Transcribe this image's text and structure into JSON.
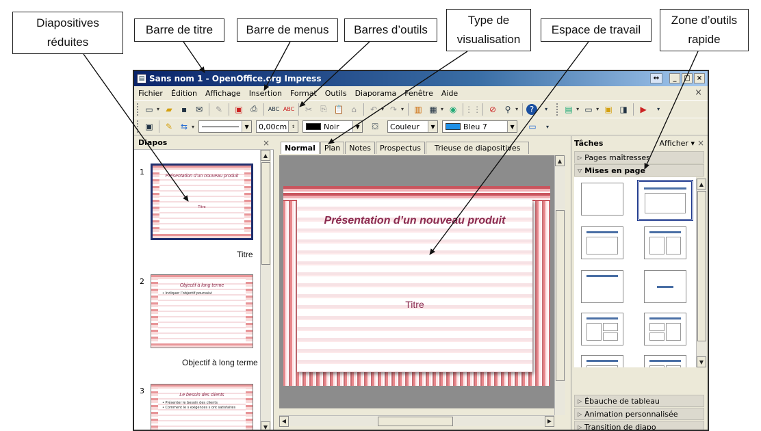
{
  "callouts": {
    "diapositives_reduites": "Diapositives\nréduites",
    "barre_titre": "Barre de titre",
    "barre_menus": "Barre de menus",
    "barres_outils": "Barres d’outils",
    "type_visualisation": "Type de\nvisualisation",
    "espace_travail": "Espace de travail",
    "zone_outils": "Zone d’outils\nrapide"
  },
  "window": {
    "title": "Sans nom 1 - OpenOffice.org Impress",
    "app_icon": "impress-doc-icon"
  },
  "menus": [
    "Fichier",
    "Édition",
    "Affichage",
    "Insertion",
    "Format",
    "Outils",
    "Diaporama",
    "Fenêtre",
    "Aide"
  ],
  "toolbar2": {
    "line_width": "0,00cm",
    "line_color": "Noir",
    "fill_type": "Couleur",
    "fill_color": "Bleu 7",
    "colors": {
      "noir": "#000000",
      "bleu7": "#1e90e6"
    }
  },
  "slides_panel": {
    "title": "Diapos",
    "slides": [
      {
        "num": "1",
        "title": "Présentation d’un nouveau produit",
        "subtitle": "Titre",
        "caption": "Titre"
      },
      {
        "num": "2",
        "title": "Objectif à long terme",
        "bullets": [
          "Indiquer l’objectif poursuivi"
        ],
        "caption": "Objectif à long terme"
      },
      {
        "num": "3",
        "title": "Le besoin des clients",
        "bullets": [
          "Présenter le besoin des clients",
          "Comment le s exigences s ont satisfaites"
        ]
      }
    ]
  },
  "view_tabs": [
    "Normal",
    "Plan",
    "Notes",
    "Prospectus",
    "Trieuse de diapositives"
  ],
  "main_slide": {
    "title": "Présentation d’un nouveau produit",
    "subtitle": "Titre"
  },
  "tasks": {
    "title": "Tâches",
    "view_label": "Afficher",
    "sections": [
      "Pages maîtresses",
      "Mises en page",
      "Ébauche de tableau",
      "Animation personnalisée",
      "Transition de diapo"
    ]
  }
}
